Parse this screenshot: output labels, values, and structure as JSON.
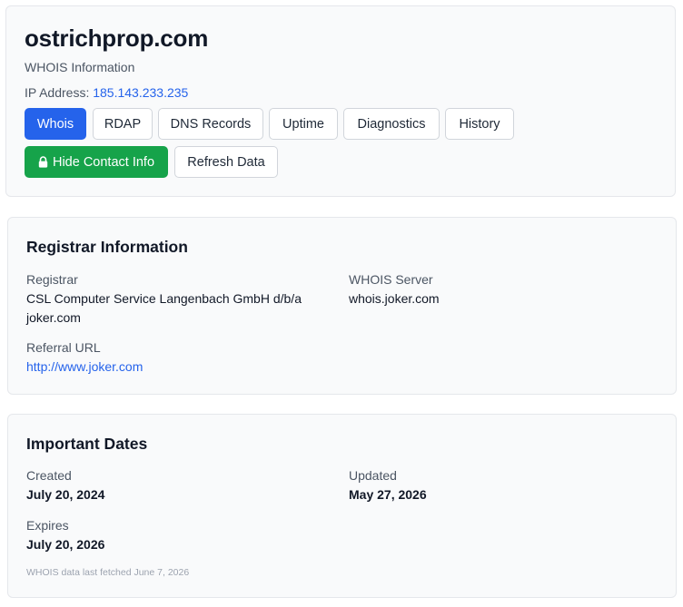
{
  "header": {
    "domain": "ostrichprop.com",
    "subtitle": "WHOIS Information",
    "ip_label": "IP Address:",
    "ip_value": "185.143.233.235"
  },
  "tabs": [
    {
      "label": "Whois",
      "active": true
    },
    {
      "label": "RDAP",
      "active": false
    },
    {
      "label": "DNS Records",
      "active": false
    },
    {
      "label": "Uptime",
      "active": false
    },
    {
      "label": "Diagnostics",
      "active": false
    },
    {
      "label": "History",
      "active": false
    }
  ],
  "actions": {
    "hide_contact_label": "Hide Contact Info",
    "refresh_label": "Refresh Data",
    "lock_icon": "lock-icon"
  },
  "registrar": {
    "title": "Registrar Information",
    "registrar_label": "Registrar",
    "registrar_value_line1": "CSL Computer Service Langenbach GmbH d/b/a",
    "registrar_value_line2": "joker.com",
    "whois_server_label": "WHOIS Server",
    "whois_server_value": "whois.joker.com",
    "referral_url_label": "Referral URL",
    "referral_url_value": "http://www.joker.com"
  },
  "dates": {
    "title": "Important Dates",
    "created_label": "Created",
    "created_value": "July 20, 2024",
    "updated_label": "Updated",
    "updated_value": "May 27, 2026",
    "expires_label": "Expires",
    "expires_value": "July 20, 2026",
    "footnote": "WHOIS data last fetched June 7, 2026"
  },
  "colors": {
    "primary": "#2563eb",
    "success": "#16a34a",
    "card_bg": "#f9fafb",
    "border": "#e5e7eb"
  }
}
